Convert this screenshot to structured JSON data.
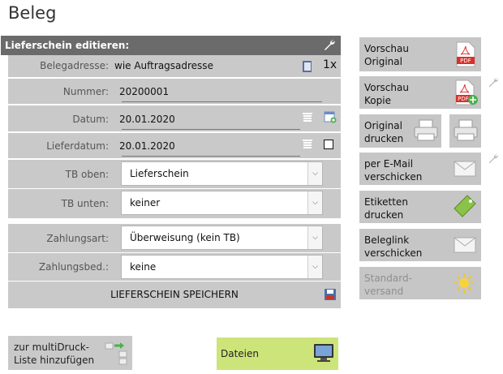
{
  "page": {
    "title": "Beleg"
  },
  "panel": {
    "header": "Lieferschein editieren:"
  },
  "form": {
    "belegadresse": {
      "label": "Belegadresse:",
      "value": "wie Auftragsadresse",
      "copies": "1x"
    },
    "nummer": {
      "label": "Nummer:",
      "value": "20200001"
    },
    "datum": {
      "label": "Datum:",
      "value": "20.01.2020"
    },
    "lieferdatum": {
      "label": "Lieferdatum:",
      "value": "20.01.2020"
    },
    "tb_oben": {
      "label": "TB oben:",
      "value": "Lieferschein"
    },
    "tb_unten": {
      "label": "TB unten:",
      "value": "keiner"
    },
    "zahlungsart": {
      "label": "Zahlungsart:",
      "value": "Überweisung (kein TB)"
    },
    "zahlungsbed": {
      "label": "Zahlungsbed.:",
      "value": "keine"
    },
    "save_label": "LIEFERSCHEIN SPEICHERN"
  },
  "actions": {
    "vorschau_original": [
      "Vorschau",
      "Original"
    ],
    "vorschau_kopie": [
      "Vorschau",
      "Kopie"
    ],
    "original_drucken": [
      "Original",
      "drucken"
    ],
    "email": [
      "per E-Mail",
      "verschicken"
    ],
    "etiketten": [
      "Etiketten",
      "drucken"
    ],
    "beleglink": [
      "Beleglink",
      "verschicken"
    ],
    "standardversand": [
      "Standard-",
      "versand"
    ]
  },
  "bottom": {
    "multidruck": [
      "zur multiDruck-",
      "Liste hinzufügen"
    ],
    "dateien": "Dateien"
  },
  "icons": {
    "pdf": "pdf-icon",
    "printer": "printer-icon",
    "envelope": "envelope-icon",
    "tag": "tag-icon",
    "sun": "sun-icon",
    "monitor": "monitor-icon",
    "save": "floppy-icon",
    "wrench": "wrench-icon"
  },
  "colors": {
    "header_bg": "#6b6b6b",
    "row_bg": "#c9c9c9",
    "dateien_bg": "#cde47a",
    "pdf_red": "#d9302c"
  }
}
